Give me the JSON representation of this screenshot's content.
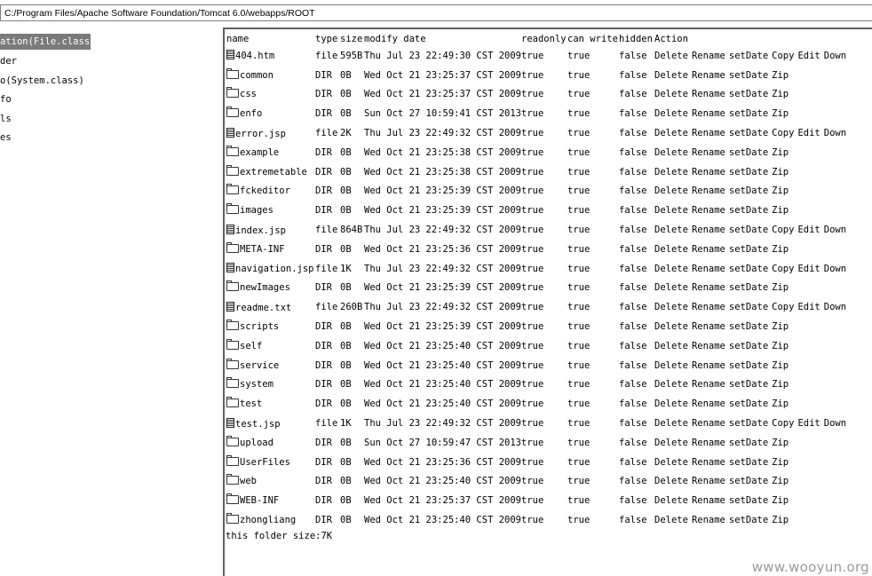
{
  "path_bar": {
    "value": "C:/Program Files/Apache Software Foundation/Tomcat 6.0/webapps/ROOT"
  },
  "sidebar": {
    "items": [
      {
        "label": "ation(File.class)"
      },
      {
        "label": "der"
      },
      {
        "label": "o(System.class)"
      },
      {
        "label": "fo"
      },
      {
        "label": "ls"
      },
      {
        "label": "es"
      }
    ]
  },
  "table": {
    "headers": {
      "name": "name",
      "type": "type",
      "size": "size",
      "date": "modify date",
      "readonly": "readonly",
      "canwrite": "can write",
      "hidden": "hidden",
      "action": "Action"
    },
    "action_labels": {
      "delete": "Delete",
      "rename": "Rename",
      "setdate": "setDate",
      "copy": "Copy",
      "edit": "Edit",
      "down": "Down",
      "zip": "Zip"
    },
    "rows": [
      {
        "kind": "file",
        "name": "404.htm",
        "type": "file",
        "size": "595B",
        "date": "Thu Jul 23 22:49:30 CST 2009",
        "readonly": "true",
        "canwrite": "true",
        "hidden": "false"
      },
      {
        "kind": "dir",
        "name": "common",
        "type": "DIR",
        "size": "0B",
        "date": "Wed Oct 21 23:25:37 CST 2009",
        "readonly": "true",
        "canwrite": "true",
        "hidden": "false"
      },
      {
        "kind": "dir",
        "name": "css",
        "type": "DIR",
        "size": "0B",
        "date": "Wed Oct 21 23:25:37 CST 2009",
        "readonly": "true",
        "canwrite": "true",
        "hidden": "false"
      },
      {
        "kind": "dir",
        "name": "enfo",
        "type": "DIR",
        "size": "0B",
        "date": "Sun Oct 27 10:59:41 CST 2013",
        "readonly": "true",
        "canwrite": "true",
        "hidden": "false"
      },
      {
        "kind": "file",
        "name": "error.jsp",
        "type": "file",
        "size": "2K",
        "date": "Thu Jul 23 22:49:32 CST 2009",
        "readonly": "true",
        "canwrite": "true",
        "hidden": "false"
      },
      {
        "kind": "dir",
        "name": "example",
        "type": "DIR",
        "size": "0B",
        "date": "Wed Oct 21 23:25:38 CST 2009",
        "readonly": "true",
        "canwrite": "true",
        "hidden": "false"
      },
      {
        "kind": "dir",
        "name": "extremetable",
        "type": "DIR",
        "size": "0B",
        "date": "Wed Oct 21 23:25:38 CST 2009",
        "readonly": "true",
        "canwrite": "true",
        "hidden": "false"
      },
      {
        "kind": "dir",
        "name": "fckeditor",
        "type": "DIR",
        "size": "0B",
        "date": "Wed Oct 21 23:25:39 CST 2009",
        "readonly": "true",
        "canwrite": "true",
        "hidden": "false"
      },
      {
        "kind": "dir",
        "name": "images",
        "type": "DIR",
        "size": "0B",
        "date": "Wed Oct 21 23:25:39 CST 2009",
        "readonly": "true",
        "canwrite": "true",
        "hidden": "false"
      },
      {
        "kind": "file",
        "name": "index.jsp",
        "type": "file",
        "size": "864B",
        "date": "Thu Jul 23 22:49:32 CST 2009",
        "readonly": "true",
        "canwrite": "true",
        "hidden": "false"
      },
      {
        "kind": "dir",
        "name": "META-INF",
        "type": "DIR",
        "size": "0B",
        "date": "Wed Oct 21 23:25:36 CST 2009",
        "readonly": "true",
        "canwrite": "true",
        "hidden": "false"
      },
      {
        "kind": "file",
        "name": "navigation.jsp",
        "type": "file",
        "size": "1K",
        "date": "Thu Jul 23 22:49:32 CST 2009",
        "readonly": "true",
        "canwrite": "true",
        "hidden": "false"
      },
      {
        "kind": "dir",
        "name": "newImages",
        "type": "DIR",
        "size": "0B",
        "date": "Wed Oct 21 23:25:39 CST 2009",
        "readonly": "true",
        "canwrite": "true",
        "hidden": "false"
      },
      {
        "kind": "file",
        "name": "readme.txt",
        "type": "file",
        "size": "260B",
        "date": "Thu Jul 23 22:49:32 CST 2009",
        "readonly": "true",
        "canwrite": "true",
        "hidden": "false"
      },
      {
        "kind": "dir",
        "name": "scripts",
        "type": "DIR",
        "size": "0B",
        "date": "Wed Oct 21 23:25:39 CST 2009",
        "readonly": "true",
        "canwrite": "true",
        "hidden": "false"
      },
      {
        "kind": "dir",
        "name": "self",
        "type": "DIR",
        "size": "0B",
        "date": "Wed Oct 21 23:25:40 CST 2009",
        "readonly": "true",
        "canwrite": "true",
        "hidden": "false"
      },
      {
        "kind": "dir",
        "name": "service",
        "type": "DIR",
        "size": "0B",
        "date": "Wed Oct 21 23:25:40 CST 2009",
        "readonly": "true",
        "canwrite": "true",
        "hidden": "false"
      },
      {
        "kind": "dir",
        "name": "system",
        "type": "DIR",
        "size": "0B",
        "date": "Wed Oct 21 23:25:40 CST 2009",
        "readonly": "true",
        "canwrite": "true",
        "hidden": "false"
      },
      {
        "kind": "dir",
        "name": "test",
        "type": "DIR",
        "size": "0B",
        "date": "Wed Oct 21 23:25:40 CST 2009",
        "readonly": "true",
        "canwrite": "true",
        "hidden": "false"
      },
      {
        "kind": "file",
        "name": "test.jsp",
        "type": "file",
        "size": "1K",
        "date": "Thu Jul 23 22:49:32 CST 2009",
        "readonly": "true",
        "canwrite": "true",
        "hidden": "false"
      },
      {
        "kind": "dir",
        "name": "upload",
        "type": "DIR",
        "size": "0B",
        "date": "Sun Oct 27 10:59:47 CST 2013",
        "readonly": "true",
        "canwrite": "true",
        "hidden": "false"
      },
      {
        "kind": "dir",
        "name": "UserFiles",
        "type": "DIR",
        "size": "0B",
        "date": "Wed Oct 21 23:25:36 CST 2009",
        "readonly": "true",
        "canwrite": "true",
        "hidden": "false"
      },
      {
        "kind": "dir",
        "name": "web",
        "type": "DIR",
        "size": "0B",
        "date": "Wed Oct 21 23:25:40 CST 2009",
        "readonly": "true",
        "canwrite": "true",
        "hidden": "false"
      },
      {
        "kind": "dir",
        "name": "WEB-INF",
        "type": "DIR",
        "size": "0B",
        "date": "Wed Oct 21 23:25:37 CST 2009",
        "readonly": "true",
        "canwrite": "true",
        "hidden": "false"
      },
      {
        "kind": "dir",
        "name": "zhongliang",
        "type": "DIR",
        "size": "0B",
        "date": "Wed Oct 21 23:25:40 CST 2009",
        "readonly": "true",
        "canwrite": "true",
        "hidden": "false"
      }
    ]
  },
  "footer": {
    "folder_size": "this folder size:7K"
  },
  "watermark": {
    "text": "www.wooyun.org"
  }
}
